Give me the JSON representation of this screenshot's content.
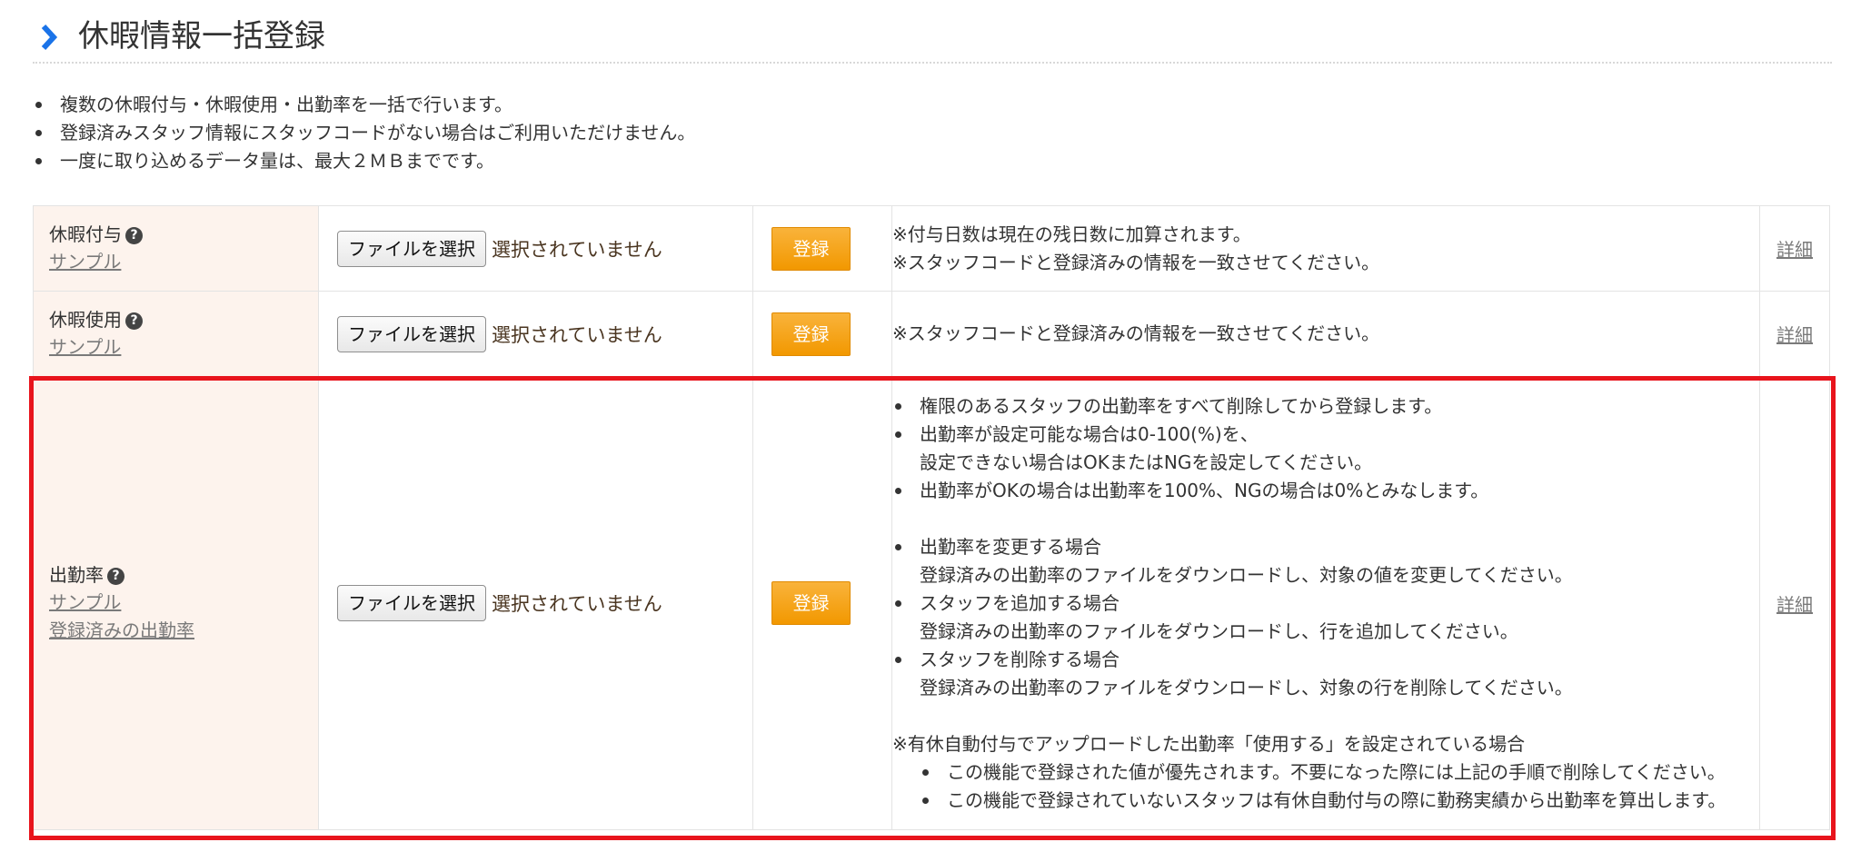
{
  "page": {
    "title": "休暇情報一括登録",
    "intro": [
      "複数の休暇付与・休暇使用・出勤率を一括で行います。",
      "登録済みスタッフ情報にスタッフコードがない場合はご利用いただけません。",
      "一度に取り込めるデータ量は、最大２ＭＢまでです。"
    ]
  },
  "colors": {
    "label_bg": "#fdf3ed",
    "register_button": "#f29800",
    "highlight_border": "#e8141c",
    "chevron": "#1a73e8"
  },
  "common": {
    "file_button": "ファイルを選択",
    "no_file": "選択されていません",
    "register": "登録",
    "detail": "詳細",
    "help_icon": "?"
  },
  "rows": [
    {
      "label": "休暇付与",
      "links": [
        "サンプル"
      ],
      "notes": [
        "※付与日数は現在の残日数に加算されます。",
        "※スタッフコードと登録済みの情報を一致させてください。"
      ]
    },
    {
      "label": "休暇使用",
      "links": [
        "サンプル"
      ],
      "notes": [
        "※スタッフコードと登録済みの情報を一致させてください。"
      ]
    },
    {
      "label": "出勤率",
      "links": [
        "サンプル",
        "登録済みの出勤率"
      ],
      "bullets1": [
        {
          "line1": "権限のあるスタッフの出勤率をすべて削除してから登録します。"
        },
        {
          "line1": "出勤率が設定可能な場合は0-100(%)を、",
          "line2": "設定できない場合はOKまたはNGを設定してください。"
        },
        {
          "line1": "出勤率がOKの場合は出勤率を100%、NGの場合は0%とみなします。"
        }
      ],
      "bullets2": [
        {
          "line1": "出勤率を変更する場合",
          "line2": "登録済みの出勤率のファイルをダウンロードし、対象の値を変更してください。"
        },
        {
          "line1": "スタッフを追加する場合",
          "line2": "登録済みの出勤率のファイルをダウンロードし、行を追加してください。"
        },
        {
          "line1": "スタッフを削除する場合",
          "line2": "登録済みの出勤率のファイルをダウンロードし、対象の行を削除してください。"
        }
      ],
      "footnote": "※有休自動付与でアップロードした出勤率「使用する」を設定されている場合",
      "sub_bullets": [
        "この機能で登録された値が優先されます。不要になった際には上記の手順で削除してください。",
        "この機能で登録されていないスタッフは有休自動付与の際に勤務実績から出勤率を算出します。"
      ]
    }
  ]
}
